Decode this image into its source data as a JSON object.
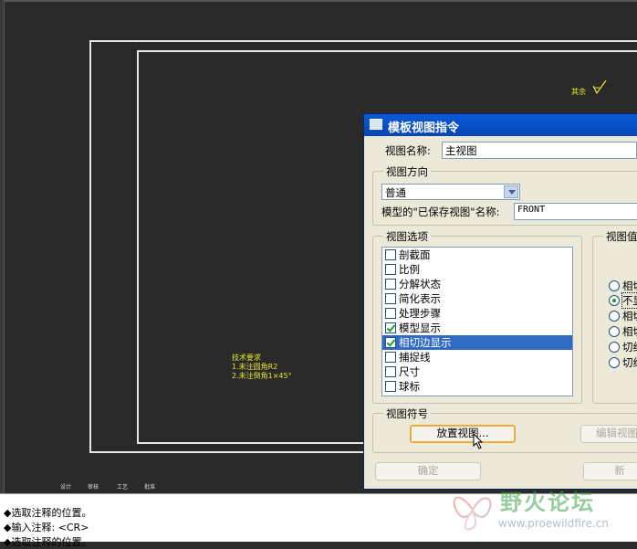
{
  "drawing": {
    "tech_req_title": "技术要求",
    "tech_req_line1": "1.未注圆角R2",
    "tech_req_line2": "2.未注倒角1×45°",
    "roughness_label": "其余",
    "title_block_cells": [
      "设计",
      "审核",
      "工艺",
      "批准"
    ]
  },
  "dialog": {
    "title": "模板视图指令",
    "view_name_label": "视图名称:",
    "view_name_value": "主视图",
    "orientation_group": "视图方向",
    "orientation_value": "普通",
    "saved_view_label": "模型的\"已保存视图\"名称:",
    "saved_view_value": "FRONT",
    "options_group": "视图选项",
    "options": [
      {
        "label": "剖截面",
        "checked": false
      },
      {
        "label": "比例",
        "checked": false
      },
      {
        "label": "分解状态",
        "checked": false
      },
      {
        "label": "简化表示",
        "checked": false
      },
      {
        "label": "处理步骤",
        "checked": false
      },
      {
        "label": "模型显示",
        "checked": true
      },
      {
        "label": "相切边显示",
        "checked": true,
        "selected": true
      },
      {
        "label": "捕捉线",
        "checked": false
      },
      {
        "label": "尺寸",
        "checked": false
      },
      {
        "label": "球标",
        "checked": false
      }
    ],
    "values_group": "视图值",
    "radios": [
      {
        "label": "相切",
        "on": false
      },
      {
        "label": "不显",
        "on": true
      },
      {
        "label": "相切",
        "on": false
      },
      {
        "label": "相切",
        "on": false
      },
      {
        "label": "切线",
        "on": false
      },
      {
        "label": "切线",
        "on": false
      }
    ],
    "symbol_group": "视图符号",
    "place_view_button": "放置视图...",
    "edit_view_button": "编辑视图",
    "ok_button": "确定",
    "new_button": "新"
  },
  "console": {
    "line1": "◆选取注释的位置。",
    "line2": "◆输入注释:   <CR>",
    "line3": "◆选取注释的位置。"
  },
  "watermark": {
    "title": "野火论坛",
    "url": "www.proewildfire.cn"
  },
  "colors": {
    "canvas": "#2a2a2a",
    "annotation_yellow": "#e6e62a",
    "titlebar": "#0a5ad8",
    "selection": "#316ac5"
  }
}
